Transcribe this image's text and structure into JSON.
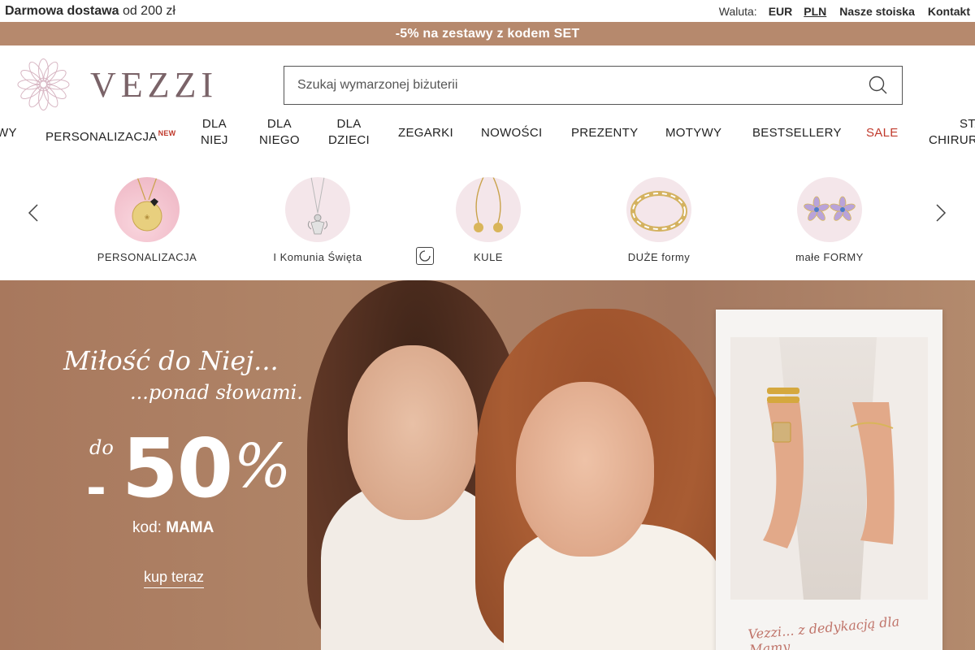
{
  "topbar": {
    "shipping_bold": "Darmowa dostawa",
    "shipping_rest": "od 200 zł",
    "currency_label": "Waluta:",
    "currencies": [
      "EUR",
      "PLN"
    ],
    "active_currency": "PLN",
    "links": [
      "Nasze stoiska",
      "Kontakt"
    ]
  },
  "promo": {
    "text": "-5% na zestawy z kodem SET"
  },
  "header": {
    "logo_text": "VEZZI",
    "search_placeholder": "Szukaj wymarzonej biżuterii"
  },
  "nav": {
    "items": [
      {
        "line1": "WY",
        "line2": ""
      },
      {
        "line1": "PERSONALIZACJA",
        "line2": "",
        "badge": "NEW"
      },
      {
        "line1": "DLA",
        "line2": "NIEJ"
      },
      {
        "line1": "DLA",
        "line2": "NIEGO"
      },
      {
        "line1": "DLA",
        "line2": "DZIECI"
      },
      {
        "line1": "ZEGARKI",
        "line2": ""
      },
      {
        "line1": "NOWOŚCI",
        "line2": ""
      },
      {
        "line1": "PREZENTY",
        "line2": ""
      },
      {
        "line1": "MOTYWY",
        "line2": ""
      },
      {
        "line1": "BESTSELLERY",
        "line2": ""
      },
      {
        "line1": "SALE",
        "line2": ""
      },
      {
        "line1": "STA",
        "line2": "CHIRUR"
      }
    ]
  },
  "categories": {
    "items": [
      {
        "label": "PERSONALIZACJA",
        "icon": "engraved-pendant-image"
      },
      {
        "label": "I Komunia Święta",
        "icon": "angel-necklace-image"
      },
      {
        "label": "KULE",
        "icon": "ball-necklace-image"
      },
      {
        "label": "DUŻE formy",
        "icon": "chunky-bracelet-image"
      },
      {
        "label": "małe FORMY",
        "icon": "flower-earrings-image"
      }
    ]
  },
  "hero": {
    "script_line1": "Miłość do Niej...",
    "script_line2": "...ponad słowami.",
    "discount_prefix": "do",
    "discount_sign": "-",
    "discount_value": "50",
    "discount_unit": "%",
    "code_label": "kod:",
    "code_value": "MAMA",
    "cta": "kup teraz",
    "polaroid_caption": "Vezzi... z dedykacją dla Mamy"
  },
  "colors": {
    "promo_bg": "#b6896d",
    "hero_bg": "#a57b61",
    "sale": "#c0392b",
    "logo": "#7a6368"
  }
}
